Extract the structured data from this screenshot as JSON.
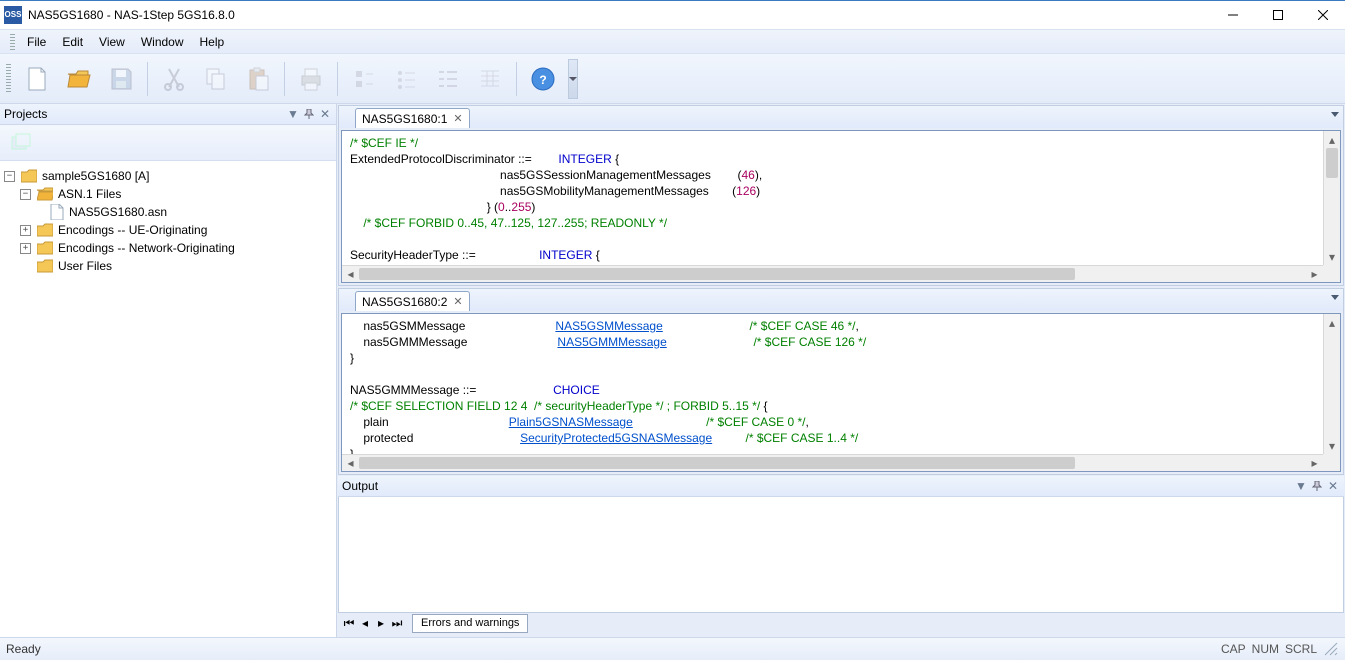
{
  "window": {
    "app_badge": "OSS",
    "title": "NAS5GS1680 - NAS-1Step 5GS16.8.0"
  },
  "menu": {
    "items": [
      "File",
      "Edit",
      "View",
      "Window",
      "Help"
    ]
  },
  "projects_panel": {
    "title": "Projects",
    "tree": {
      "root": "sample5GS1680 [A]",
      "asn_folder": "ASN.1 Files",
      "asn_file": "NAS5GS1680.asn",
      "enc_ue": "Encodings -- UE-Originating",
      "enc_nw": "Encodings -- Network-Originating",
      "user_files": "User Files"
    }
  },
  "editor1": {
    "tab": "NAS5GS1680:1",
    "l1": "/* $CEF IE */",
    "l2a": "ExtendedProtocolDiscriminator ::=        ",
    "l2b": "INTEGER",
    "l2c": " {",
    "l3a": "                                             nas5GSSessionManagementMessages        (",
    "l3b": "46",
    "l3c": "),",
    "l4a": "                                             nas5GSMobilityManagementMessages       (",
    "l4b": "126",
    "l4c": ")",
    "l5a": "                                         } (",
    "l5b": "0",
    "l5c": "..",
    "l5d": "255",
    "l5e": ")",
    "l6": "    /* $CEF FORBID 0..45, 47..125, 127..255; READONLY */",
    "l7a": "SecurityHeaderType ::=                   ",
    "l7b": "INTEGER",
    "l7c": " {"
  },
  "editor2": {
    "tab": "NAS5GS1680:2",
    "l1a": "    nas5GSMMessage                           ",
    "l1b": "NAS5GSMMessage",
    "l1c": "                          ",
    "l1d": "/* $CEF CASE 46 */",
    "l1e": ",",
    "l2a": "    nas5GMMMessage                           ",
    "l2b": "NAS5GMMMessage",
    "l2c": "                          ",
    "l2d": "/* $CEF CASE 126 */",
    "l3": "}",
    "l5a": "NAS5GMMMessage ::=                       ",
    "l5b": "CHOICE",
    "l6a": "/* $CEF SELECTION FIELD 12 4  /* securityHeaderType */ ; FORBID 5..15 */",
    "l6b": " {",
    "l7a": "    plain                                    ",
    "l7b": "Plain5GSNASMessage",
    "l7c": "                      ",
    "l7d": "/* $CEF CASE 0 */",
    "l7e": ",",
    "l8a": "    protected                                ",
    "l8b": "SecurityProtected5GSNASMessage",
    "l8c": "          ",
    "l8d": "/* $CEF CASE 1..4 */",
    "l9": "}"
  },
  "output": {
    "title": "Output",
    "tab": "Errors and warnings"
  },
  "status": {
    "ready": "Ready",
    "cap": "CAP",
    "num": "NUM",
    "scrl": "SCRL"
  }
}
